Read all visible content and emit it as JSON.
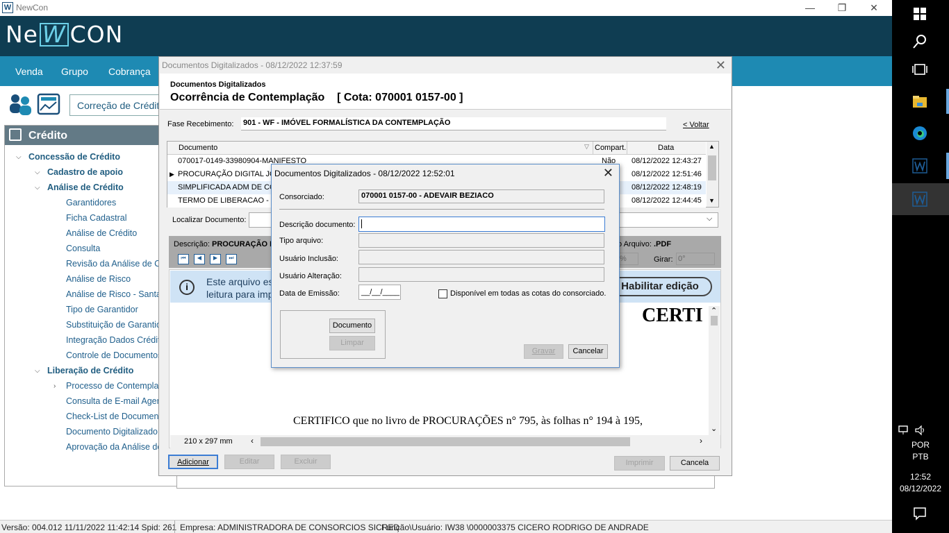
{
  "app": {
    "title": "NewCon",
    "logo_left": "Ne",
    "logo_box": "W",
    "logo_right": "CON"
  },
  "menu": [
    "Venda",
    "Grupo",
    "Cobrança"
  ],
  "toolbar": {
    "correcao": "Correção de Crédito"
  },
  "sidebar": {
    "title": "Crédito",
    "items": [
      {
        "label": "Concessão de Crédito",
        "level": 0,
        "bold": true,
        "chev": "v"
      },
      {
        "label": "Cadastro de apoio",
        "level": 1,
        "bold": true,
        "chev": "v"
      },
      {
        "label": "Análise de Crédito",
        "level": 1,
        "bold": true,
        "chev": "v"
      },
      {
        "label": "Garantidores",
        "level": 2
      },
      {
        "label": "Ficha Cadastral",
        "level": 2
      },
      {
        "label": "Análise de Crédito",
        "level": 2
      },
      {
        "label": "Consulta",
        "level": 2
      },
      {
        "label": "Revisão da Análise de C",
        "level": 2
      },
      {
        "label": "Análise de Risco",
        "level": 2
      },
      {
        "label": "Análise de Risco - Santa",
        "level": 2
      },
      {
        "label": "Tipo de Garantidor",
        "level": 2
      },
      {
        "label": "Substituição de Garantid",
        "level": 2
      },
      {
        "label": "Integração Dados Crédit",
        "level": 2
      },
      {
        "label": "Controle de Documentos",
        "level": 2
      },
      {
        "label": "Liberação de Crédito",
        "level": 1,
        "bold": true,
        "chev": "v"
      },
      {
        "label": "Processo de Contempla",
        "level": 2,
        "chev": ">"
      },
      {
        "label": "Consulta de E-mail Agen",
        "level": 2
      },
      {
        "label": "Check-List de Documen",
        "level": 2
      },
      {
        "label": "Documento Digitalizado",
        "level": 2
      },
      {
        "label": "Aprovação da Análise de",
        "level": 2
      }
    ]
  },
  "dialog1": {
    "caption": "Documentos Digitalizados - 08/12/2022  12:37:59",
    "subtitle": "Documentos Digitalizados",
    "title": "Ocorrência de Contemplação    [ Cota: 070001 0157-00 ]",
    "fase_label": "Fase Recebimento:",
    "fase_value": "901 - WF - IMÓVEL FORMALÍSTICA DA CONTEMPLAÇÃO",
    "voltar": "< Voltar",
    "columns": [
      "Documento",
      "Compart.",
      "Data"
    ],
    "rows": [
      {
        "doc": "070017-0149-33980904-MANIFESTO",
        "comp": "Não",
        "data": "08/12/2022 12:43:27"
      },
      {
        "doc": "PROCURAÇÃO DIGITAL JO",
        "comp": "",
        "data": "08/12/2022 12:51:46"
      },
      {
        "doc": "SIMPLIFICADA ADM DE CON",
        "comp": "",
        "data": "08/12/2022 12:48:19"
      },
      {
        "doc": "TERMO DE LIBERACAO - 07",
        "comp": "",
        "data": "08/12/2022 12:44:45"
      }
    ],
    "localizar": "Localizar Documento:",
    "descricao_label": "Descrição:",
    "descricao_value": "PROCURAÇÃO D",
    "tipo_arquivo_label": "o Arquivo:",
    "tipo_arquivo_value": ".PDF",
    "zoom": "%",
    "girar_label": "Girar:",
    "girar_value": "0°",
    "info_text1": "Este arquivo est",
    "info_text2": "leitura para imp",
    "habilitar": "Habilitar edição",
    "doc_heading": "CERTI",
    "doc_body": "CERTIFICO que no livro de PROCURAÇÕES n° 795, às folhas n° 194 à 195,",
    "page_size": "210 x 297 mm",
    "buttons": {
      "adicionar": "Adicionar",
      "editar": "Editar",
      "excluir": "Excluir",
      "imprimir": "Imprimir",
      "cancela": "Cancela"
    }
  },
  "dialog2": {
    "caption": "Documentos Digitalizados - 08/12/2022  12:52:01",
    "consorciado_label": "Consorciado:",
    "consorciado_value": "070001 0157-00 - ADEVAIR BEZIACO",
    "descricao_label": "Descrição documento:",
    "tipo_label": "Tipo arquivo:",
    "usuario_inc_label": "Usuário Inclusão:",
    "usuario_alt_label": "Usuário Alteração:",
    "data_label": "Data de Emissão:",
    "data_value": "__/__/____",
    "disponivel": "Disponível em todas as cotas do consorciado.",
    "documento_btn": "Documento",
    "limpar_btn": "Limpar",
    "gravar_btn": "Gravar",
    "cancelar_btn": "Cancelar"
  },
  "status": {
    "versao": "Versão: 004.012  11/11/2022 11:42:14  Spid: 261",
    "empresa": "Empresa: ADMINISTRADORA DE CONSORCIOS SICRED",
    "funcao": "Função\\Usuário: IW38  \\0000003375 CICERO RODRIGO DE ANDRADE"
  },
  "taskbar": {
    "lang1": "POR",
    "lang2": "PTB",
    "time": "12:52",
    "date": "08/12/2022"
  }
}
